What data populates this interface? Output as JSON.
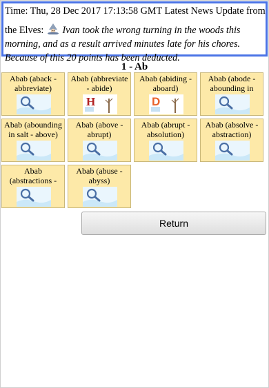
{
  "news": {
    "prefix": "Time: Thu, 28 Dec 2017 17:13:58 GMT Latest News Update from the Elves:",
    "line1": "Time: Thu, 28 Dec 2017 17:13:58 GMT Latest News Update from",
    "line2_start": "the Elves:",
    "story": "Ivan took the wrong turning in the woods this morning, and as a result arrived minutes late for his chores. Because of this 20 points has been deducted."
  },
  "section_title": "1 - Ab",
  "tiles": [
    {
      "label": "Abab (aback - abbreviate)",
      "icon": "magnifier-icon"
    },
    {
      "label": "Abab (abbreviate - abide)",
      "icon": "letter-h-tree-icon"
    },
    {
      "label": "Abab (abiding - aboard)",
      "icon": "letter-d-tree-icon"
    },
    {
      "label": "Abab (abode - abounding in milk)",
      "icon": "magnifier-icon"
    },
    {
      "label": "Abab (abounding in salt - above)",
      "icon": "magnifier-icon"
    },
    {
      "label": "Abab (above - abrupt)",
      "icon": "magnifier-icon"
    },
    {
      "label": "Abab (abrupt - absolution)",
      "icon": "magnifier-icon"
    },
    {
      "label": "Abab (absolve - abstraction)",
      "icon": "magnifier-icon"
    },
    {
      "label": "Abab (abstractions - abuse)",
      "icon": "magnifier-icon"
    },
    {
      "label": "Abab (abuse - abyss)",
      "icon": "magnifier-icon"
    }
  ],
  "return_label": "Return",
  "colors": {
    "border_accent": "#4a73e6",
    "tile_bg": "#fde9a8",
    "letter_h": "#b22222",
    "letter_d": "#e8622a"
  }
}
